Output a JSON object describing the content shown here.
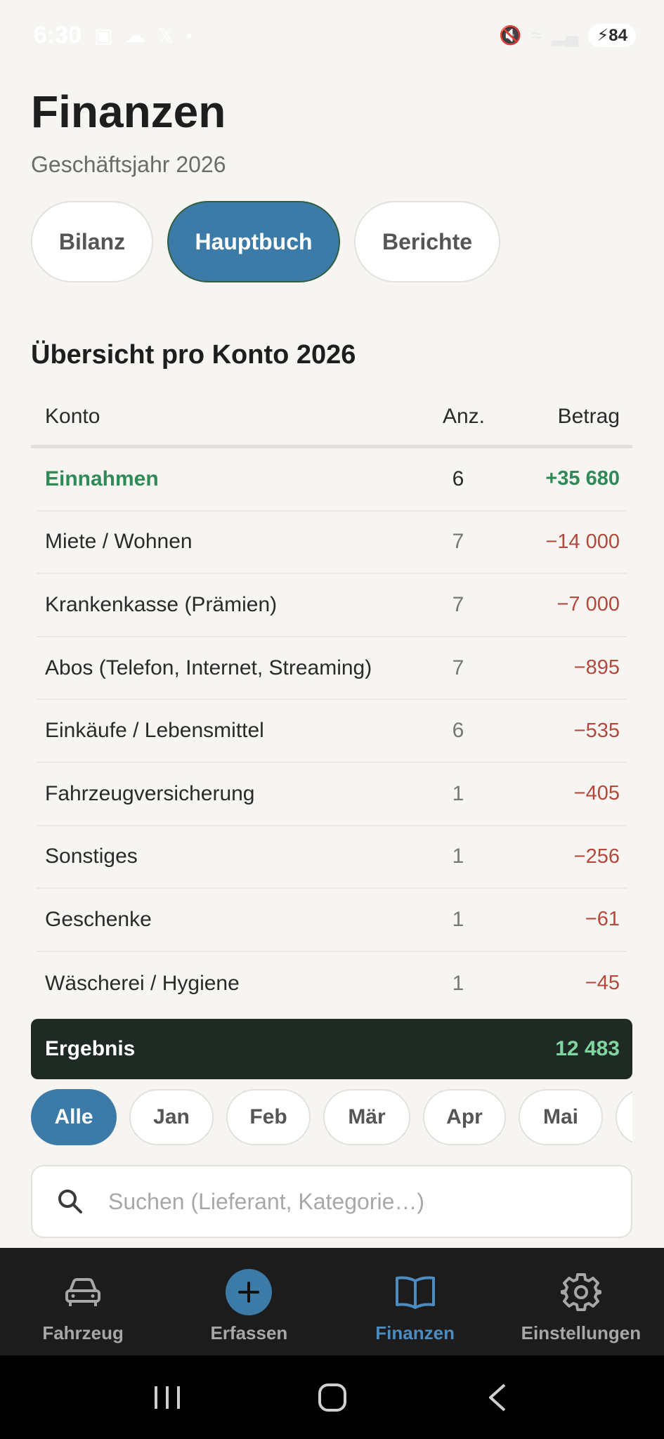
{
  "status_bar": {
    "time": "6:30",
    "battery": "84",
    "left_icons": [
      "screenshot-icon",
      "cloud-icon",
      "x-logo-icon",
      "dot-icon"
    ],
    "right_icons": [
      "mute-icon",
      "wifi-icon",
      "signal-icon"
    ]
  },
  "header": {
    "title": "Finanzen",
    "subtitle": "Geschäftsjahr 2026"
  },
  "segments": [
    {
      "label": "Bilanz",
      "active": false
    },
    {
      "label": "Hauptbuch",
      "active": true
    },
    {
      "label": "Berichte",
      "active": false
    }
  ],
  "overview": {
    "title": "Übersicht pro Konto 2026",
    "columns": {
      "name": "Konto",
      "count": "Anz.",
      "amount": "Betrag"
    },
    "rows": [
      {
        "name": "Einnahmen",
        "count": "6",
        "amount": "+35 680",
        "type": "income"
      },
      {
        "name": "Miete / Wohnen",
        "count": "7",
        "amount": "−14 000",
        "type": "expense"
      },
      {
        "name": "Krankenkasse (Prämien)",
        "count": "7",
        "amount": "−7 000",
        "type": "expense"
      },
      {
        "name": "Abos (Telefon, Internet, Streaming)",
        "count": "7",
        "amount": "−895",
        "type": "expense"
      },
      {
        "name": "Einkäufe / Lebensmittel",
        "count": "6",
        "amount": "−535",
        "type": "expense"
      },
      {
        "name": "Fahrzeugversicherung",
        "count": "1",
        "amount": "−405",
        "type": "expense"
      },
      {
        "name": "Sonstiges",
        "count": "1",
        "amount": "−256",
        "type": "expense"
      },
      {
        "name": "Geschenke",
        "count": "1",
        "amount": "−61",
        "type": "expense"
      },
      {
        "name": "Wäscherei / Hygiene",
        "count": "1",
        "amount": "−45",
        "type": "expense"
      }
    ],
    "result": {
      "label": "Ergebnis",
      "value": "12 483"
    }
  },
  "months": [
    {
      "label": "Alle",
      "active": true
    },
    {
      "label": "Jan",
      "active": false
    },
    {
      "label": "Feb",
      "active": false
    },
    {
      "label": "Mär",
      "active": false
    },
    {
      "label": "Apr",
      "active": false
    },
    {
      "label": "Mai",
      "active": false
    }
  ],
  "search": {
    "placeholder": "Suchen (Lieferant, Kategorie…)"
  },
  "bottom_nav": [
    {
      "label": "Fahrzeug",
      "icon": "car-icon",
      "active": false
    },
    {
      "label": "Erfassen",
      "icon": "plus-icon",
      "active": false
    },
    {
      "label": "Finanzen",
      "icon": "book-icon",
      "active": true
    },
    {
      "label": "Einstellungen",
      "icon": "gear-icon",
      "active": false
    }
  ],
  "colors": {
    "accent": "#3c7aa8",
    "income": "#2f8a56",
    "expense": "#b5483a",
    "result_bg": "#1f2a24",
    "result_value": "#7fd6a0",
    "background": "#f6f5f2"
  }
}
